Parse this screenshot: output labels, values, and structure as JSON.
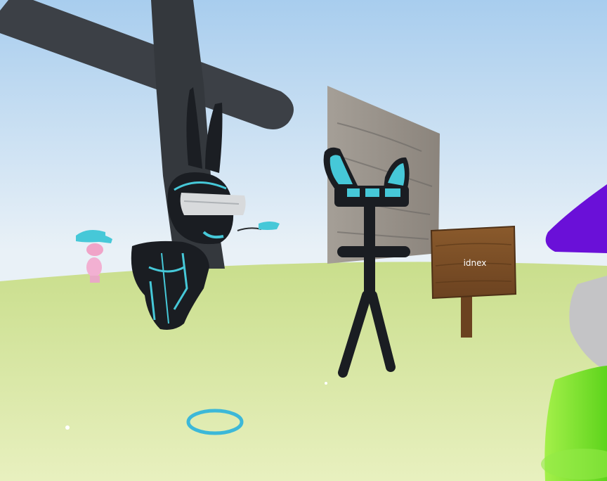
{
  "world": {
    "sign_label": "idnex"
  },
  "colors": {
    "sky_top": "#a9cdee",
    "sky_bottom": "#e8f0f6",
    "ground": "#dbe9a8",
    "accent": "#46c8d8",
    "avatar_body": "#1a1d22",
    "pole": "#3a3d42",
    "purple": "#6a10d8",
    "green": "#7be030"
  },
  "icons": {
    "teleport_ring": "ring-icon"
  }
}
